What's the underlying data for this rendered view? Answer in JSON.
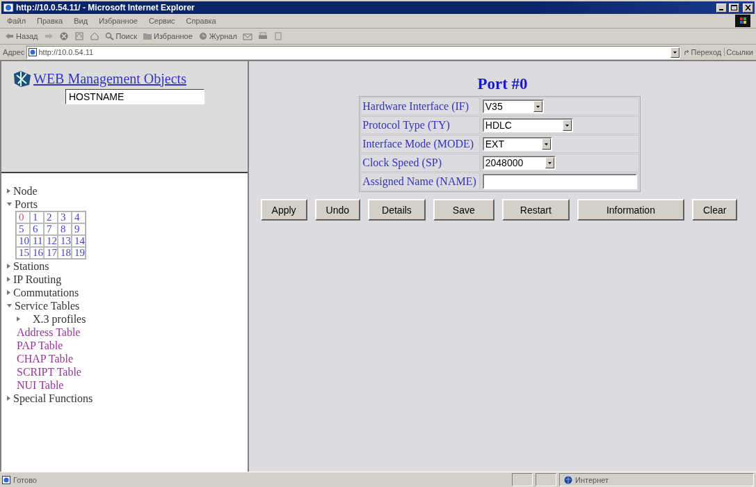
{
  "window": {
    "title": "http://10.0.54.11/ - Microsoft Internet Explorer"
  },
  "menu": [
    {
      "label": "Файл"
    },
    {
      "label": "Правка"
    },
    {
      "label": "Вид"
    },
    {
      "label": "Избранное"
    },
    {
      "label": "Сервис"
    },
    {
      "label": "Справка"
    }
  ],
  "toolbar": [
    {
      "kind": "back",
      "label": "Назад"
    },
    {
      "kind": "forward"
    },
    {
      "kind": "stop"
    },
    {
      "kind": "refresh"
    },
    {
      "kind": "home"
    },
    {
      "kind": "search",
      "label": "Поиск"
    },
    {
      "kind": "favorites",
      "label": "Избранное"
    },
    {
      "kind": "history",
      "label": "Журнал"
    },
    {
      "kind": "mail"
    },
    {
      "kind": "print"
    },
    {
      "kind": "edit"
    }
  ],
  "address": {
    "label": "Адрес",
    "value": "http://10.0.54.11",
    "go": "Переход",
    "links": "Ссылки"
  },
  "logo": {
    "title": "WEB Management Objects",
    "hostname": "HOSTNAME"
  },
  "nav": [
    {
      "label": "Node",
      "expanded": false
    },
    {
      "label": "Ports",
      "expanded": true,
      "ports": [
        {
          "label": "0",
          "visited": true
        },
        {
          "label": "1",
          "visited": false
        },
        {
          "label": "2",
          "visited": false
        },
        {
          "label": "3",
          "visited": false
        },
        {
          "label": "4",
          "visited": false
        },
        {
          "label": "5",
          "visited": false
        },
        {
          "label": "6",
          "visited": false
        },
        {
          "label": "7",
          "visited": false
        },
        {
          "label": "8",
          "visited": false
        },
        {
          "label": "9",
          "visited": false
        },
        {
          "label": "10",
          "visited": false
        },
        {
          "label": "11",
          "visited": false
        },
        {
          "label": "12",
          "visited": false
        },
        {
          "label": "13",
          "visited": false
        },
        {
          "label": "14",
          "visited": false
        },
        {
          "label": "15",
          "visited": false
        },
        {
          "label": "16",
          "visited": false
        },
        {
          "label": "17",
          "visited": false
        },
        {
          "label": "18",
          "visited": false
        },
        {
          "label": "19",
          "visited": false
        }
      ]
    },
    {
      "label": "Stations",
      "expanded": false
    },
    {
      "label": "IP Routing",
      "expanded": false
    },
    {
      "label": "Commutations",
      "expanded": false
    },
    {
      "label": "Service Tables",
      "expanded": true,
      "children": [
        {
          "kind": "folder",
          "label": "X.3 profiles",
          "expanded": false
        },
        {
          "kind": "link",
          "label": "Address Table",
          "visited": true
        },
        {
          "kind": "link",
          "label": "PAP Table",
          "visited": true
        },
        {
          "kind": "link",
          "label": "CHAP Table",
          "visited": true
        },
        {
          "kind": "link",
          "label": "SCRIPT Table",
          "visited": true
        },
        {
          "kind": "link",
          "label": "NUI Table",
          "visited": true
        }
      ]
    },
    {
      "label": "Special Functions",
      "expanded": false
    }
  ],
  "form": {
    "title": "Port #0",
    "fields": [
      {
        "label": "Hardware Interface (IF)",
        "kind": "select",
        "value": "V35"
      },
      {
        "label": "Protocol Type (TY)",
        "kind": "select",
        "value": "HDLC"
      },
      {
        "label": "Interface Mode (MODE)",
        "kind": "select",
        "value": "EXT"
      },
      {
        "label": "Clock Speed (SP)",
        "kind": "select",
        "value": "2048000"
      },
      {
        "label": "Assigned Name (NAME)",
        "kind": "text"
      }
    ]
  },
  "buttons": [
    {
      "label": "Apply"
    },
    {
      "label": "Undo"
    },
    {
      "label": "Details"
    },
    {
      "label": "Save"
    },
    {
      "label": "Restart"
    },
    {
      "label": "Information"
    },
    {
      "label": "Clear"
    }
  ],
  "status": {
    "text": "Готово",
    "zone": "Интернет"
  }
}
